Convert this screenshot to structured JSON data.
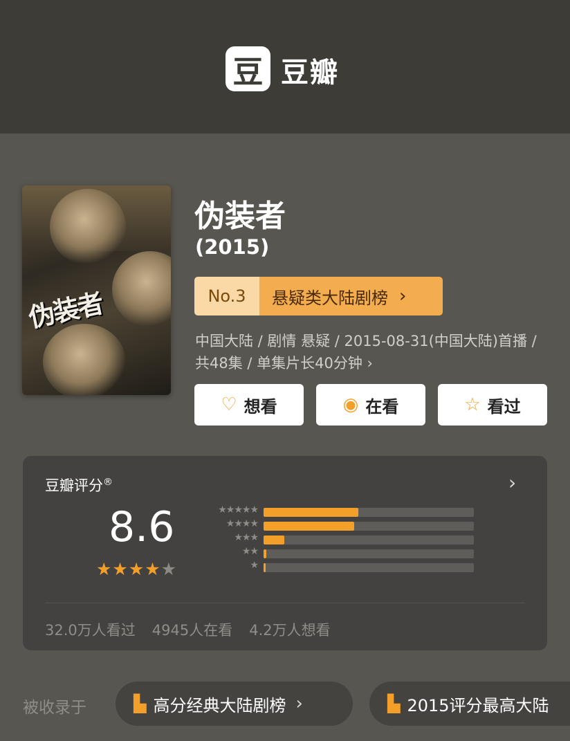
{
  "header": {
    "logo_glyph": "豆",
    "app_name": "豆瓣"
  },
  "movie": {
    "poster_text": "伪装者",
    "title": "伪装者",
    "year": "(2015)",
    "rank": {
      "no": "No.3",
      "name": "悬疑类大陆剧榜",
      "arrow": "›"
    },
    "meta_line": "中国大陆 / 剧情 悬疑 / 2015-08-31(中国大陆)首播 / 共48集 / 单集片长40分钟 ›"
  },
  "actions": [
    {
      "icon": "heart-plus-icon",
      "glyph": "♡",
      "label": "想看"
    },
    {
      "icon": "watching-icon",
      "glyph": "◉",
      "label": "在看"
    },
    {
      "icon": "star-outline-icon",
      "glyph": "☆",
      "label": "看过"
    }
  ],
  "rating": {
    "label": "豆瓣评分",
    "registered_mark": "®",
    "chevron": "›",
    "score": "8.6",
    "stars_full": "★★★★",
    "stars_half": "★",
    "distribution": [
      {
        "stars": "★★★★★",
        "fraction": 0.45
      },
      {
        "stars": "★★★★",
        "fraction": 0.43
      },
      {
        "stars": "★★★",
        "fraction": 0.1
      },
      {
        "stars": "★★",
        "fraction": 0.013
      },
      {
        "stars": "★",
        "fraction": 0.008
      }
    ],
    "counts": {
      "watched": "32.0万人看过",
      "watching": "4945人在看",
      "want": "4.2万人想看"
    }
  },
  "collections": {
    "label": "被收录于",
    "items": [
      {
        "label": "高分经典大陆剧榜",
        "chevron": "›"
      },
      {
        "label": "2015评分最高大陆",
        "chevron": ""
      }
    ]
  },
  "colors": {
    "accent": "#f3a02b",
    "header_bg": "#3d3c37",
    "page_bg": "#585650",
    "card_bg": "#434240"
  }
}
